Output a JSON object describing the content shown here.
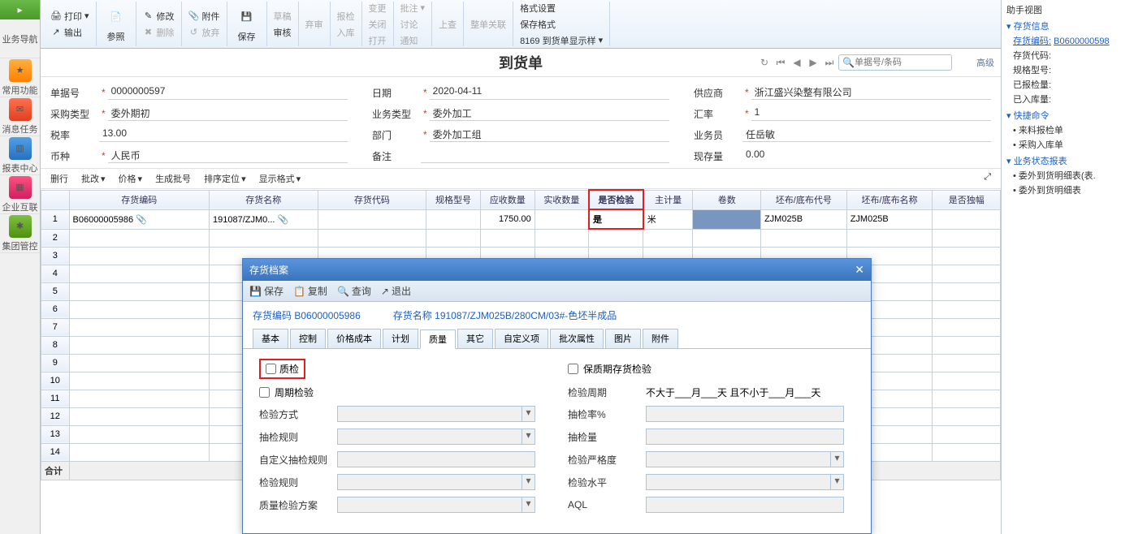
{
  "leftNav": {
    "label1": "业务导航",
    "label2": "常用功能",
    "label3": "消息任务",
    "label4": "报表中心",
    "label5": "企业互联",
    "label6": "集团管控"
  },
  "ribbon": {
    "print": "打印",
    "output": "输出",
    "canzhao": "参照",
    "modify": "修改",
    "delete": "删除",
    "attach": "附件",
    "fangqi": "放弃",
    "save": "保存",
    "draft": "草稿",
    "audit": "审核",
    "shenhe2": "弃审",
    "baojian": "报检",
    "ruku": "入库",
    "change": "变更",
    "close": "关闭",
    "open": "打开",
    "pizhu": "批注",
    "taolun": "讨论",
    "tongzhi": "通知",
    "shangcha": "上查",
    "zhengdan": "整单关联",
    "geshi": "格式设置",
    "baocungs": "保存格式",
    "template": "8169 到货单显示样"
  },
  "doc": {
    "title": "到货单",
    "searchPlaceholder": "单据号/条码",
    "advanced": "高级"
  },
  "form": {
    "danjuhao": {
      "label": "单据号",
      "value": "0000000597"
    },
    "riqi": {
      "label": "日期",
      "value": "2020-04-11"
    },
    "gongyingshang": {
      "label": "供应商",
      "value": "浙江盛兴染整有限公司"
    },
    "caigouleixing": {
      "label": "采购类型",
      "value": "委外期初"
    },
    "yewuleixing": {
      "label": "业务类型",
      "value": "委外加工"
    },
    "huilv": {
      "label": "汇率",
      "value": "1"
    },
    "shuilv": {
      "label": "税率",
      "value": "13.00"
    },
    "bumen": {
      "label": "部门",
      "value": "委外加工组"
    },
    "yewuyuan": {
      "label": "业务员",
      "value": "任岳敏"
    },
    "bizhong": {
      "label": "币种",
      "value": "人民币"
    },
    "beizhu": {
      "label": "备注",
      "value": ""
    },
    "xianliang": {
      "label": "现存量",
      "value": "0.00"
    }
  },
  "gridToolbar": {
    "delRow": "删行",
    "pigai": "批改",
    "price": "价格",
    "genBatch": "生成批号",
    "sortPos": "排序定位",
    "dispFmt": "显示格式"
  },
  "gridCols": {
    "c1": "存货编码",
    "c2": "存货名称",
    "c3": "存货代码",
    "c4": "规格型号",
    "c5": "应收数量",
    "c6": "实收数量",
    "c7": "是否检验",
    "c8": "主计量",
    "c9": "卷数",
    "c10": "坯布/底布代号",
    "c11": "坯布/底布名称",
    "c12": "是否独幅"
  },
  "gridRow": {
    "code": "B06000005986",
    "name": "191087/ZJM0...",
    "qty": "1750.00",
    "inspect": "是",
    "unit": "米",
    "p1": "ZJM025B",
    "p2": "ZJM025B"
  },
  "gridFooter": "合计",
  "dialog": {
    "title": "存货档案",
    "tb": {
      "save": "保存",
      "copy": "复制",
      "query": "查询",
      "exit": "退出"
    },
    "info": {
      "codeLabel": "存货编码",
      "code": "B06000005986",
      "nameLabel": "存货名称",
      "name": "191087/ZJM025B/280CM/03#-色坯半成品"
    },
    "tabs": {
      "t1": "基本",
      "t2": "控制",
      "t3": "价格成本",
      "t4": "计划",
      "t5": "质量",
      "t6": "其它",
      "t7": "自定义项",
      "t8": "批次属性",
      "t9": "图片",
      "t10": "附件"
    },
    "fields": {
      "zhijian": "质检",
      "baozhi": "保质期存货检验",
      "zhouqi": "周期检验",
      "jyzq": "检验周期",
      "jyzq_val": "不大于___月___天 且不小于___月___天",
      "jyfs": "检验方式",
      "cjlp": "抽检率%",
      "cjgz": "抽检规则",
      "cjl": "抽检量",
      "zdy": "自定义抽检规则",
      "jyyg": "检验严格度",
      "jygz": "检验规则",
      "jysp": "检验水平",
      "zljyfa": "质量检验方案",
      "aql": "AQL"
    }
  },
  "rightPanel": {
    "title": "助手视图",
    "sec1": "存货信息",
    "l1a": "存货编码:",
    "l1b": "B0600000598",
    "l2": "存货代码:",
    "l3": "规格型号:",
    "l4": "已报检量:",
    "l5": "已入库量:",
    "sec2": "快捷命令",
    "q1": "来料报检单",
    "q2": "采购入库单",
    "sec3": "业务状态报表",
    "r1": "委外到货明细表(表.",
    "r2": "委外到货明细表"
  }
}
